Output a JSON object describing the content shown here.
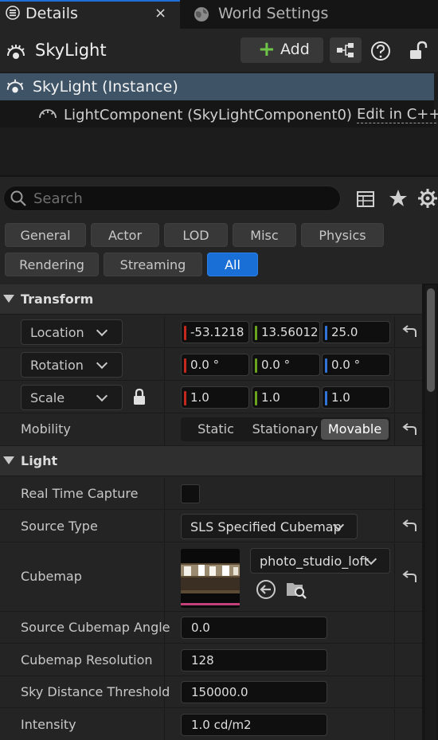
{
  "tabs": [
    {
      "label": "Details",
      "close": "×",
      "icon": "details-icon",
      "active": true
    },
    {
      "label": "World Settings",
      "icon": "globe-icon",
      "active": false
    }
  ],
  "header": {
    "title": "SkyLight",
    "add_label": "Add",
    "add_plus": "+"
  },
  "components": [
    {
      "label": "SkyLight (Instance)",
      "selected": true
    },
    {
      "label": "LightComponent (SkyLightComponent0)",
      "edit": "Edit in C++"
    }
  ],
  "search": {
    "placeholder": "Search"
  },
  "filters": [
    "General",
    "Actor",
    "LOD",
    "Misc",
    "Physics",
    "Rendering",
    "Streaming",
    "All"
  ],
  "active_filter": "All",
  "transform": {
    "title": "Transform",
    "location": {
      "label": "Location",
      "x": "-53.1218",
      "y": "13.56012",
      "z": "25.0"
    },
    "rotation": {
      "label": "Rotation",
      "x": "0.0 °",
      "y": "0.0 °",
      "z": "0.0 °"
    },
    "scale": {
      "label": "Scale",
      "x": "1.0",
      "y": "1.0",
      "z": "1.0"
    },
    "mobility": {
      "label": "Mobility",
      "options": [
        "Static",
        "Stationary",
        "Movable"
      ],
      "selected": "Movable"
    }
  },
  "light": {
    "title": "Light",
    "real_time_capture": {
      "label": "Real Time Capture",
      "checked": false
    },
    "source_type": {
      "label": "Source Type",
      "value": "SLS Specified Cubemap"
    },
    "cubemap": {
      "label": "Cubemap",
      "value": "photo_studio_loft"
    },
    "source_cubemap_angle": {
      "label": "Source Cubemap Angle",
      "value": "0.0"
    },
    "cubemap_resolution": {
      "label": "Cubemap Resolution",
      "value": "128"
    },
    "sky_distance_threshold": {
      "label": "Sky Distance Threshold",
      "value": "150000.0"
    },
    "intensity": {
      "label": "Intensity",
      "value": "1.0 cd/m2"
    }
  },
  "colors": {
    "accent": "#1a6fd7",
    "selection": "#3e5366",
    "x_axis": "#c5281c",
    "y_axis": "#6aa31e",
    "z_axis": "#2f74d6"
  }
}
